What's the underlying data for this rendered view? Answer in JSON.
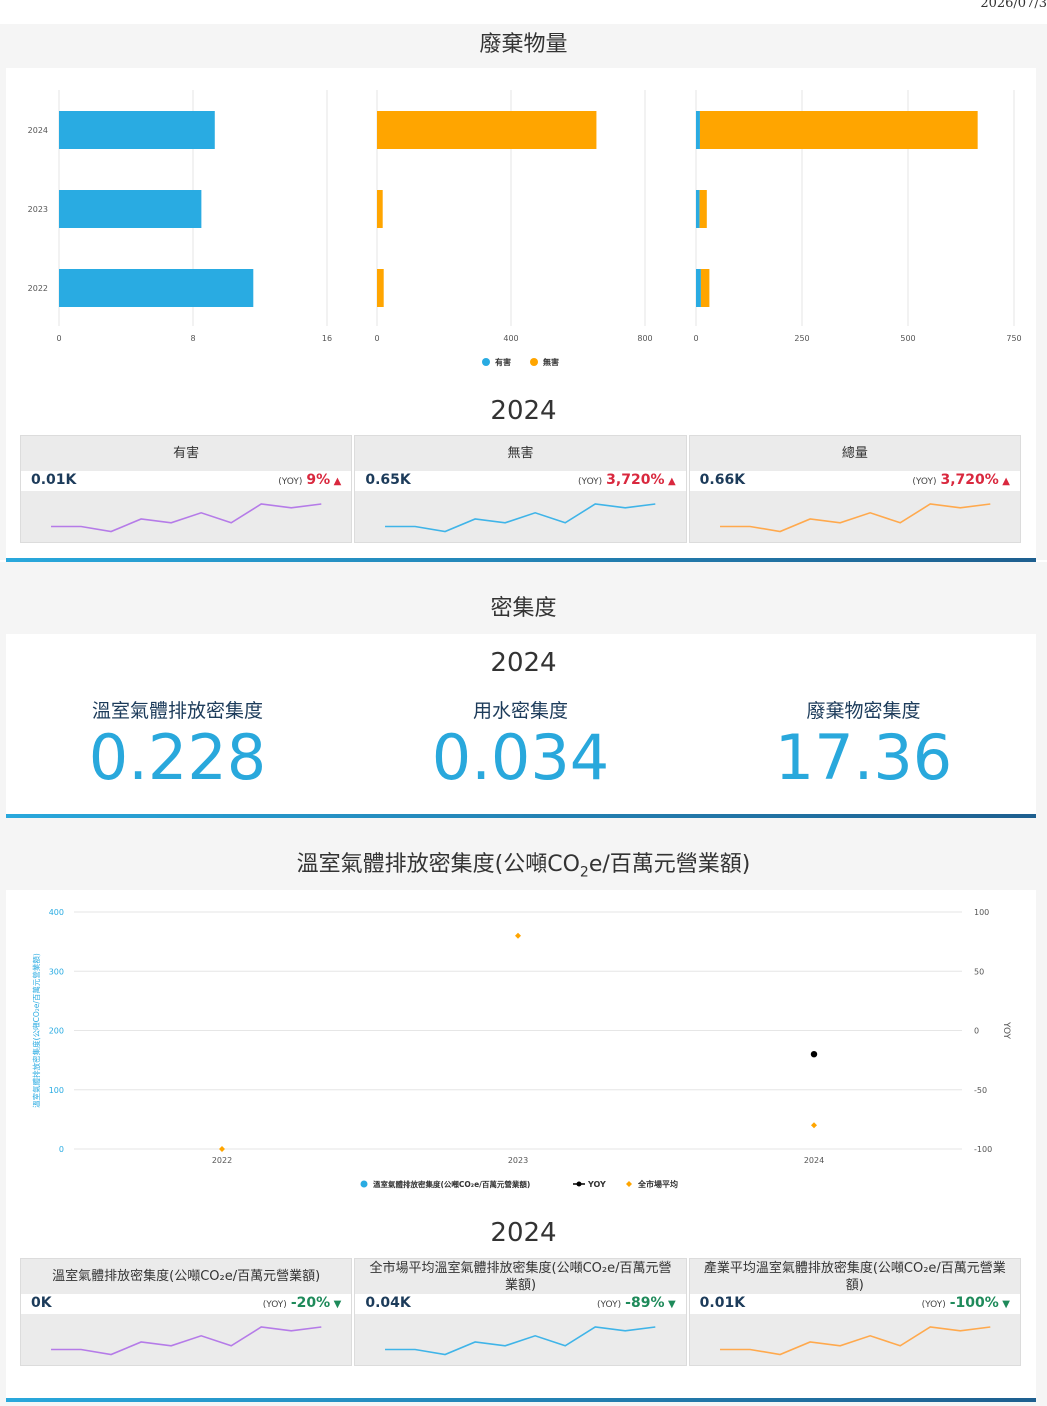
{
  "date_stamp": "2026/07/3",
  "waste": {
    "title": "廢棄物量",
    "year": "2024",
    "legend": [
      {
        "name": "有害",
        "color": "#29abe2"
      },
      {
        "name": "無害",
        "color": "#ffa500"
      }
    ],
    "kpis": [
      {
        "name": "有害",
        "value": "0.01K",
        "yoy_tag": "(YOY)",
        "yoy": "9%",
        "direction": "up",
        "yoy_color": "#d9283e",
        "spark_color": "#b57be8"
      },
      {
        "name": "無害",
        "value": "0.65K",
        "yoy_tag": "(YOY)",
        "yoy": "3,720%",
        "direction": "up",
        "yoy_color": "#d9283e",
        "spark_color": "#3fb4e8"
      },
      {
        "name": "總量",
        "value": "0.66K",
        "yoy_tag": "(YOY)",
        "yoy": "3,720%",
        "direction": "up",
        "yoy_color": "#d9283e",
        "spark_color": "#ffa94d"
      }
    ]
  },
  "density": {
    "title": "密集度",
    "year": "2024",
    "items": [
      {
        "label": "溫室氣體排放密集度",
        "value": "0.228"
      },
      {
        "label": "用水密集度",
        "value": "0.034"
      },
      {
        "label": "廢棄物密集度",
        "value": "17.36"
      }
    ]
  },
  "ghg": {
    "title_main": "溫室氣體排放密集度(公噸CO",
    "title_sub": "2",
    "title_tail": "e/百萬元營業額)",
    "year": "2024",
    "legend": [
      {
        "name": "溫室氣體排放密集度(公噸CO₂e/百萬元營業額)",
        "color": "#29abe2",
        "symbol": "circle"
      },
      {
        "name": "YOY",
        "color": "#000000",
        "symbol": "line"
      },
      {
        "name": "全市場平均",
        "color": "#ffa500",
        "symbol": "diamond"
      }
    ],
    "kpis": [
      {
        "name": "溫室氣體排放密集度(公噸CO₂e/百萬元營業額)",
        "value": "0K",
        "yoy_tag": "(YOY)",
        "yoy": "-20%",
        "direction": "down",
        "yoy_color": "#1e8a5a",
        "spark_color": "#b57be8"
      },
      {
        "name": "全市場平均溫室氣體排放密集度(公噸CO₂e/百萬元營業額)",
        "value": "0.04K",
        "yoy_tag": "(YOY)",
        "yoy": "-89%",
        "direction": "down",
        "yoy_color": "#1e8a5a",
        "spark_color": "#3fb4e8"
      },
      {
        "name": "產業平均溫室氣體排放密集度(公噸CO₂e/百萬元營業額)",
        "value": "0.01K",
        "yoy_tag": "(YOY)",
        "yoy": "-100%",
        "direction": "down",
        "yoy_color": "#1e8a5a",
        "spark_color": "#ffa94d"
      }
    ]
  },
  "chart_data": [
    {
      "type": "bar",
      "orientation": "horizontal",
      "categories": [
        "2024",
        "2023",
        "2022"
      ],
      "series": [
        {
          "name": "有害",
          "values": [
            9.3,
            8.5,
            11.6
          ],
          "color": "#29abe2"
        }
      ],
      "xlim": [
        0,
        16
      ],
      "xticks": [
        "0",
        "8",
        "16"
      ],
      "grid": true
    },
    {
      "type": "bar",
      "orientation": "horizontal",
      "categories": [
        "2024",
        "2023",
        "2022"
      ],
      "series": [
        {
          "name": "無害",
          "values": [
            655,
            17,
            20
          ],
          "color": "#ffa500"
        }
      ],
      "xlim": [
        0,
        800
      ],
      "xticks": [
        "0",
        "400",
        "800"
      ],
      "grid": true
    },
    {
      "type": "bar",
      "orientation": "horizontal",
      "stacked": true,
      "categories": [
        "2024",
        "2023",
        "2022"
      ],
      "series": [
        {
          "name": "有害",
          "values": [
            9.3,
            8.5,
            11.6
          ],
          "color": "#29abe2"
        },
        {
          "name": "無害",
          "values": [
            655,
            17,
            20
          ],
          "color": "#ffa500"
        }
      ],
      "xlim": [
        0,
        750
      ],
      "xticks": [
        "0",
        "250",
        "500",
        "750"
      ],
      "grid": true
    },
    {
      "type": "scatter",
      "x": [
        "2022",
        "2023",
        "2024"
      ],
      "ylabel": "溫室氣體排放密集度(公噸CO₂e/百萬元營業額)",
      "y2label": "YOY",
      "ylim": [
        0,
        400
      ],
      "yticks": [
        "0",
        "100",
        "200",
        "300",
        "400"
      ],
      "y2lim": [
        -100,
        100
      ],
      "y2ticks": [
        "100",
        "50",
        "0",
        "-50",
        "-100"
      ],
      "series": [
        {
          "name": "溫室氣體排放密集度(公噸CO₂e/百萬元營業額)",
          "axis": "left",
          "values": [
            null,
            null,
            null
          ],
          "color": "#29abe2"
        },
        {
          "name": "YOY",
          "axis": "right",
          "values": [
            null,
            null,
            -20
          ],
          "color": "#000000"
        },
        {
          "name": "全市場平均",
          "axis": "left",
          "values": [
            0,
            360,
            40
          ],
          "color": "#ffa500"
        }
      ],
      "grid": true
    }
  ],
  "sparklines": {
    "values": [
      30,
      30,
      26,
      36,
      33,
      41,
      33,
      48,
      45,
      48
    ]
  }
}
